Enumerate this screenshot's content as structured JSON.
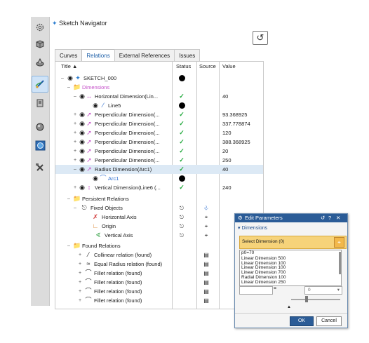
{
  "navigator": {
    "title": "Sketch Navigator",
    "undo_icon": "undo-icon"
  },
  "tabs": [
    "Curves",
    "Relations",
    "External References",
    "Issues"
  ],
  "columns": {
    "title": "Title",
    "status": "Status",
    "source": "Source",
    "value": "Value"
  },
  "tree": [
    {
      "label": "SKETCH_000",
      "value": ""
    },
    {
      "label": "Dimensions",
      "value": ""
    },
    {
      "label": "Horizontal Dimension(Lin...",
      "value": "40"
    },
    {
      "label": "Line5",
      "value": ""
    },
    {
      "label": "Perpendicular Dimension(...",
      "value": "93.368925"
    },
    {
      "label": "Perpendicular Dimension(...",
      "value": "337.778874"
    },
    {
      "label": "Perpendicular Dimension(...",
      "value": "120"
    },
    {
      "label": "Perpendicular Dimension(...",
      "value": "388.368925"
    },
    {
      "label": "Perpendicular Dimension(...",
      "value": "20"
    },
    {
      "label": "Perpendicular Dimension(...",
      "value": "250"
    },
    {
      "label": "Radius Dimension(Arc1)",
      "value": "40"
    },
    {
      "label": "Arc1",
      "value": ""
    },
    {
      "label": "Vertical Dimension(Line6 (...",
      "value": "240"
    },
    {
      "label": "Persistent Relations",
      "value": ""
    },
    {
      "label": "Fixed Objects",
      "value": ""
    },
    {
      "label": "Horizontal Axis",
      "value": ""
    },
    {
      "label": "Origin",
      "value": ""
    },
    {
      "label": "Vertical Axis",
      "value": ""
    },
    {
      "label": "Found Relations",
      "value": ""
    },
    {
      "label": "Collinear relation (found)",
      "value": ""
    },
    {
      "label": "Equal Radius relation (found)",
      "value": ""
    },
    {
      "label": "Fillet relation (found)",
      "value": ""
    },
    {
      "label": "Fillet relation (found)",
      "value": ""
    },
    {
      "label": "Fillet relation (found)",
      "value": ""
    },
    {
      "label": "Fillet relation (found)",
      "value": ""
    }
  ],
  "dialog": {
    "title": "Edit Parameters",
    "section": "Dimensions",
    "select_label": "Select Dimension (0)",
    "list": [
      "p0=70",
      "Linear Dimension 500",
      "Linear Dimension 100",
      "Linear Dimension 100",
      "Linear Dimension 700",
      "Radial Dimension 100",
      "Linear Dimension 250"
    ],
    "equals": "=",
    "dropdown_value": "0",
    "ok": "OK",
    "cancel": "Cancel"
  }
}
